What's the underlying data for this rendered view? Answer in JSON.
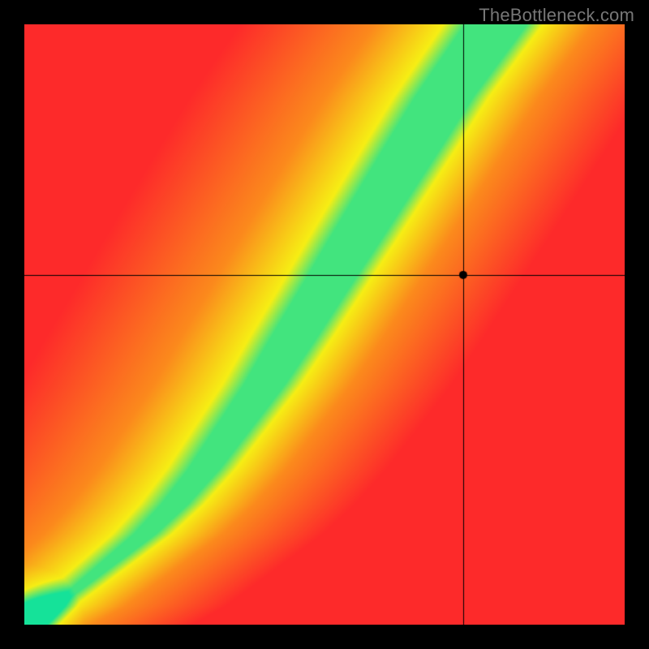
{
  "watermark": "TheBottleneck.com",
  "chart_data": {
    "type": "heatmap",
    "title": "",
    "xlabel": "",
    "ylabel": "",
    "xlim": [
      0,
      1
    ],
    "ylim": [
      0,
      1
    ],
    "grid": false,
    "legend": false,
    "crosshair": {
      "x": 0.732,
      "y": 0.582
    },
    "marker": {
      "x": 0.732,
      "y": 0.582,
      "radius": 5
    },
    "ridge": {
      "description": "Green optimal band; approximate centerline and half-width in normalized units",
      "points": [
        {
          "x": 0.0,
          "y": 0.0,
          "w": 0.003
        },
        {
          "x": 0.05,
          "y": 0.03,
          "w": 0.006
        },
        {
          "x": 0.1,
          "y": 0.07,
          "w": 0.01
        },
        {
          "x": 0.15,
          "y": 0.11,
          "w": 0.014
        },
        {
          "x": 0.2,
          "y": 0.15,
          "w": 0.018
        },
        {
          "x": 0.25,
          "y": 0.2,
          "w": 0.022
        },
        {
          "x": 0.3,
          "y": 0.26,
          "w": 0.026
        },
        {
          "x": 0.35,
          "y": 0.33,
          "w": 0.03
        },
        {
          "x": 0.4,
          "y": 0.4,
          "w": 0.034
        },
        {
          "x": 0.45,
          "y": 0.48,
          "w": 0.038
        },
        {
          "x": 0.5,
          "y": 0.56,
          "w": 0.04
        },
        {
          "x": 0.55,
          "y": 0.64,
          "w": 0.043
        },
        {
          "x": 0.6,
          "y": 0.72,
          "w": 0.045
        },
        {
          "x": 0.65,
          "y": 0.8,
          "w": 0.047
        },
        {
          "x": 0.7,
          "y": 0.88,
          "w": 0.048
        },
        {
          "x": 0.75,
          "y": 0.95,
          "w": 0.05
        },
        {
          "x": 0.8,
          "y": 1.02,
          "w": 0.052
        }
      ]
    },
    "colors": {
      "green": "#15e299",
      "yellow": "#f6ee14",
      "orange": "#fb8a1c",
      "red": "#fd2a2a"
    },
    "field": {
      "description": "Scalar field sampled on a coarse grid; 0 = on ridge (green), 1 = far (red). Derived from distance to ridge centerline.",
      "nx": 9,
      "ny": 9,
      "x": [
        0.0,
        0.125,
        0.25,
        0.375,
        0.5,
        0.625,
        0.75,
        0.875,
        1.0
      ],
      "y": [
        0.0,
        0.125,
        0.25,
        0.375,
        0.5,
        0.625,
        0.75,
        0.875,
        1.0
      ],
      "values": [
        [
          0.02,
          0.38,
          0.58,
          0.7,
          0.78,
          0.84,
          0.88,
          0.92,
          0.95
        ],
        [
          0.35,
          0.05,
          0.3,
          0.5,
          0.63,
          0.72,
          0.79,
          0.85,
          0.9
        ],
        [
          0.55,
          0.28,
          0.03,
          0.25,
          0.44,
          0.58,
          0.68,
          0.76,
          0.83
        ],
        [
          0.68,
          0.48,
          0.22,
          0.03,
          0.22,
          0.4,
          0.54,
          0.65,
          0.74
        ],
        [
          0.77,
          0.62,
          0.42,
          0.2,
          0.03,
          0.2,
          0.38,
          0.52,
          0.63
        ],
        [
          0.83,
          0.72,
          0.56,
          0.38,
          0.18,
          0.03,
          0.2,
          0.36,
          0.5
        ],
        [
          0.88,
          0.79,
          0.67,
          0.52,
          0.35,
          0.17,
          0.03,
          0.19,
          0.35
        ],
        [
          0.91,
          0.85,
          0.75,
          0.63,
          0.49,
          0.33,
          0.16,
          0.03,
          0.18
        ],
        [
          0.94,
          0.89,
          0.81,
          0.72,
          0.6,
          0.46,
          0.31,
          0.15,
          0.03
        ]
      ]
    }
  }
}
